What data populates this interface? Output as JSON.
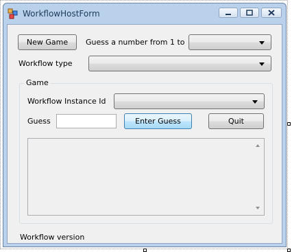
{
  "window": {
    "title": "WorkflowHostForm",
    "icons": {
      "app": "workflow-app-icon",
      "minimize": "minimize-icon",
      "maximize": "maximize-icon",
      "close": "close-icon"
    }
  },
  "form": {
    "new_game_label": "New Game",
    "guess_range_label": "Guess a number from 1 to",
    "guess_range_selected": "",
    "workflow_type_label": "Workflow type",
    "workflow_type_selected": "",
    "game_group": {
      "title": "Game",
      "instance_id_label": "Workflow Instance Id",
      "instance_id_selected": "",
      "guess_label": "Guess",
      "guess_value": "",
      "enter_guess_label": "Enter Guess",
      "quit_label": "Quit",
      "output_text": ""
    },
    "workflow_version_label": "Workflow version"
  }
}
